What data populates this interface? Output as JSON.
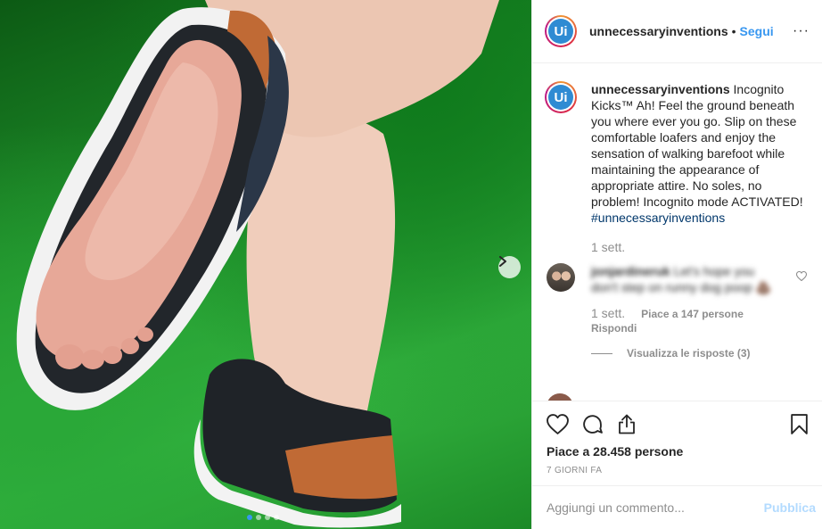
{
  "post": {
    "avatar_initials": "Ui",
    "username": "unnecessaryinventions",
    "separator": "•",
    "follow_label": "Segui",
    "more_label": "···",
    "caption": {
      "username": "unnecessaryinventions",
      "text": " Incognito Kicks™ Ah! Feel the ground beneath you where ever you go. Slip on these comfortable loafers and enjoy the sensation of walking barefoot while maintaining the appearance of appropriate attire. No soles, no problem! Incognito mode ACTIVATED! ",
      "hashtag": "#unnecessaryinventions",
      "time": "1 sett."
    },
    "comment": {
      "username": "jonjardineruk",
      "text": " Let's hope you don't step on runny dog poop 💩",
      "time": "1 sett.",
      "likes_label": "Piace a 147 persone",
      "reply_label": "Rispondi",
      "view_replies_label": "Visualizza le risposte (3)"
    },
    "likes_label": "Piace a 28.458 persone",
    "date_label": "7 GIORNI FA",
    "add_comment_placeholder": "Aggiungi un commento...",
    "publish_label": "Pubblica"
  },
  "carousel": {
    "total": 4,
    "active_index": 0
  },
  "colors": {
    "accent": "#3897f0",
    "hashtag": "#00376b",
    "muted": "#8e8e8e",
    "publish_disabled": "#b3dbff"
  },
  "icons": [
    "chevron-right-icon",
    "more-icon",
    "heart-icon",
    "comment-icon",
    "share-icon",
    "bookmark-icon"
  ]
}
